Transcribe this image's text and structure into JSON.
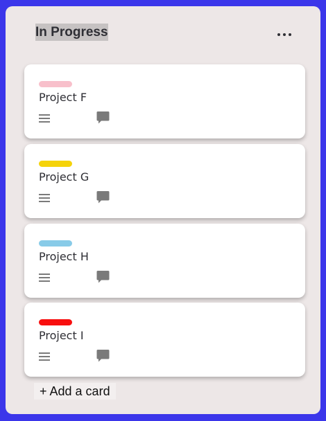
{
  "column": {
    "title": "In Progress",
    "menu_icon": "more-horizontal-icon"
  },
  "cards": [
    {
      "title": "Project F",
      "label_color": "#f8c0cb",
      "desc_icon": "description-lines-icon",
      "comment_icon": "comment-icon"
    },
    {
      "title": "Project G",
      "label_color": "#f5d30a",
      "desc_icon": "description-lines-icon",
      "comment_icon": "comment-icon"
    },
    {
      "title": "Project H",
      "label_color": "#88cbe8",
      "desc_icon": "description-lines-icon",
      "comment_icon": "comment-icon"
    },
    {
      "title": "Project I",
      "label_color": "#f80f0f",
      "desc_icon": "description-lines-icon",
      "comment_icon": "comment-icon"
    }
  ],
  "add_card_label": "+ Add a card",
  "colors": {
    "background": "#3b36ea",
    "column_bg": "#ede7e7",
    "card_bg": "#ffffff",
    "icon_gray": "#7a7a7a"
  }
}
